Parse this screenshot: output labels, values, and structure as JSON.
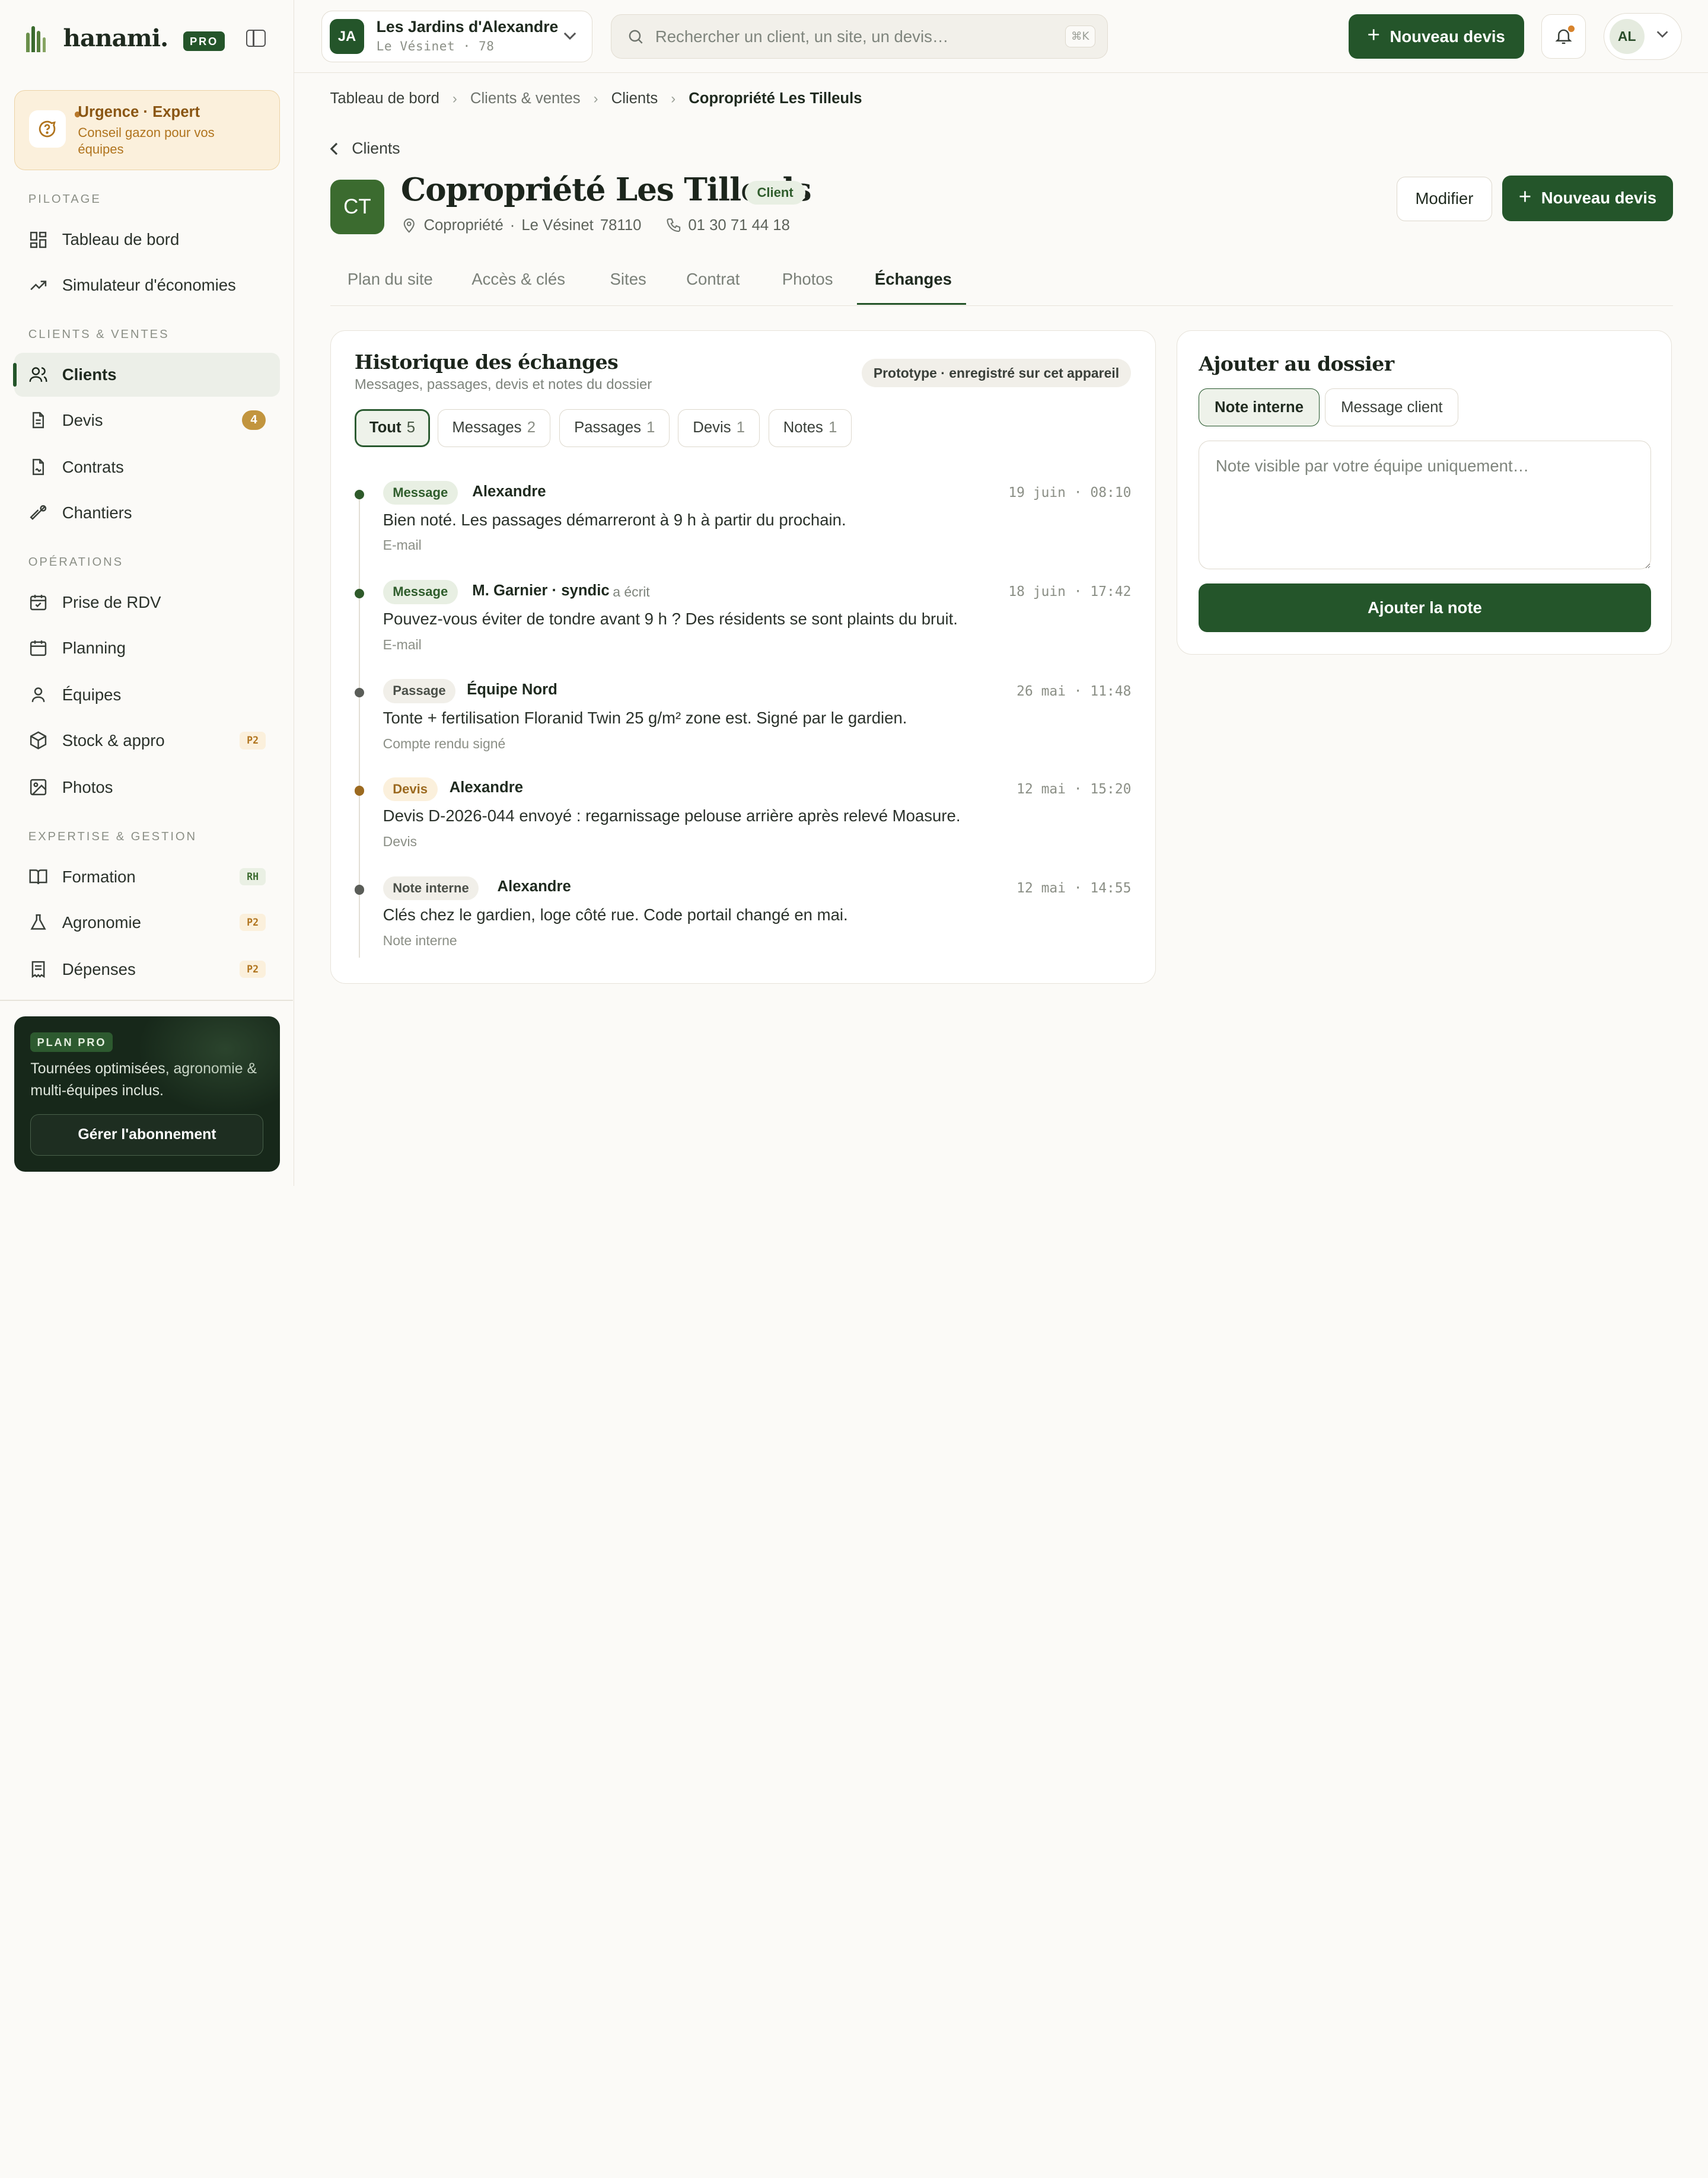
{
  "brand": {
    "name": "hanami.",
    "badge": "PRO"
  },
  "urgent": {
    "title": "Urgence · Expert",
    "subtitle": "Conseil gazon pour vos équipes"
  },
  "sidebar": {
    "sections": [
      "PILOTAGE",
      "CLIENTS & VENTES",
      "OPÉRATIONS",
      "EXPERTISE & GESTION"
    ],
    "items": [
      {
        "label": "Tableau de bord",
        "icon": "dashboard-icon"
      },
      {
        "label": "Simulateur d'économies",
        "icon": "trend-icon"
      },
      {
        "label": "Clients",
        "icon": "users-icon",
        "active": true
      },
      {
        "label": "Devis",
        "icon": "document-icon",
        "badge": "4"
      },
      {
        "label": "Contrats",
        "icon": "contract-icon"
      },
      {
        "label": "Chantiers",
        "icon": "tool-icon"
      },
      {
        "label": "Prise de RDV",
        "icon": "calendar-check-icon"
      },
      {
        "label": "Planning",
        "icon": "calendar-icon"
      },
      {
        "label": "Équipes",
        "icon": "user-icon"
      },
      {
        "label": "Stock & appro",
        "icon": "box-icon",
        "tag": "P2"
      },
      {
        "label": "Photos",
        "icon": "image-icon"
      },
      {
        "label": "Formation",
        "icon": "book-icon",
        "tag": "RH"
      },
      {
        "label": "Agronomie",
        "icon": "flask-icon",
        "tag": "P2"
      },
      {
        "label": "Dépenses",
        "icon": "receipt-icon",
        "tag": "P2"
      }
    ]
  },
  "plan": {
    "tag": "PLAN PRO",
    "text": "Tournées optimisées, agronomie & multi-équipes inclus.",
    "button": "Gérer l'abonnement"
  },
  "topbar": {
    "org": {
      "initials": "JA",
      "name": "Les Jardins d'Alexandre",
      "sub": "Le Vésinet · 78"
    },
    "search_placeholder": "Rechercher un client, un site, un devis…",
    "search_kbd": "⌘K",
    "new_quote": "Nouveau devis",
    "user_initials": "AL"
  },
  "breadcrumb": [
    "Tableau de bord",
    "Clients & ventes",
    "Clients",
    "Copropriété Les Tilleuls"
  ],
  "back_label": "Clients",
  "client": {
    "initials": "CT",
    "name": "Copropriété Les Tilleuls",
    "status": "Client",
    "type": "Copropriété",
    "city": "Le Vésinet",
    "postcode": "78110",
    "phone": "01 30 71 44 18",
    "edit_label": "Modifier",
    "new_quote": "Nouveau devis"
  },
  "tabs": [
    "Plan du site",
    "Accès & clés",
    "Sites",
    "Contrat",
    "Photos",
    "Échanges"
  ],
  "active_tab": "Échanges",
  "history": {
    "title": "Historique des échanges",
    "subtitle": "Messages, passages, devis et notes du dossier",
    "proto": "Prototype · enregistré sur cet appareil",
    "filters": [
      {
        "label": "Tout",
        "count": "5",
        "active": true
      },
      {
        "label": "Messages",
        "count": "2"
      },
      {
        "label": "Passages",
        "count": "1"
      },
      {
        "label": "Devis",
        "count": "1"
      },
      {
        "label": "Notes",
        "count": "1"
      }
    ],
    "entries": [
      {
        "type": "Message",
        "author": "Alexandre",
        "wrote": "",
        "time": "19 juin · 08:10",
        "body": "Bien noté. Les passages démarreront à 9 h à partir du prochain.",
        "source": "E-mail",
        "color": "#2e5a2a"
      },
      {
        "type": "Message",
        "author": "M. Garnier · syndic",
        "wrote": "a écrit",
        "time": "18 juin · 17:42",
        "body": "Pouvez-vous éviter de tondre avant 9 h ? Des résidents se sont plaints du bruit.",
        "source": "E-mail",
        "color": "#2e5a2a"
      },
      {
        "type": "Passage",
        "author": "Équipe Nord",
        "wrote": "",
        "time": "26 mai · 11:48",
        "body": "Tonte + fertilisation Floranid Twin 25 g/m² zone est. Signé par le gardien.",
        "source": "Compte rendu signé",
        "color": "#5a5d58"
      },
      {
        "type": "Devis",
        "author": "Alexandre",
        "wrote": "",
        "time": "12 mai · 15:20",
        "body": "Devis D-2026-044 envoyé : regarnissage pelouse arrière après relevé Moasure.",
        "source": "Devis",
        "color": "#9c6a20"
      },
      {
        "type": "Note interne",
        "author": "Alexandre",
        "wrote": "",
        "time": "12 mai · 14:55",
        "body": "Clés chez le gardien, loge côté rue. Code portail changé en mai.",
        "source": "Note interne",
        "color": "#5a5d58"
      }
    ]
  },
  "add": {
    "title": "Ajouter au dossier",
    "segments": [
      "Note interne",
      "Message client"
    ],
    "active_segment": "Note interne",
    "placeholder": "Note visible par votre équipe uniquement…",
    "submit": "Ajouter la note"
  },
  "colors": {
    "accent": "#24552a",
    "warning": "#c2953e"
  }
}
